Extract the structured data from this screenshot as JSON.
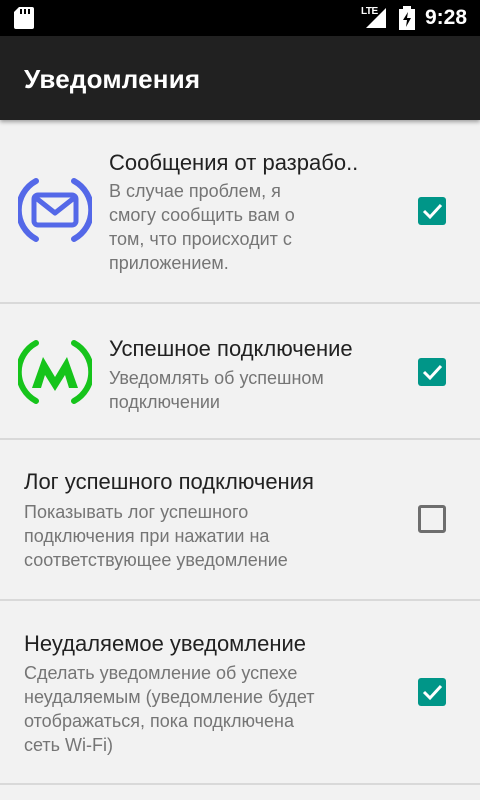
{
  "status_bar": {
    "time": "9:28",
    "network": "LTE",
    "icons": [
      "sd-card-icon",
      "signal-icon",
      "battery-charging-icon"
    ]
  },
  "app_bar": {
    "title": "Уведомления"
  },
  "colors": {
    "accent": "#009688",
    "app_bar": "#212121",
    "developer_icon": "#5468e8",
    "metro_icon": "#16c41b"
  },
  "settings": [
    {
      "title": "Сообщения от разрабо..",
      "summary": [
        "В случае проблем, я",
        "смогу сообщить вам о",
        "том, что происходит с",
        "приложением."
      ],
      "checked": true,
      "icon": "developer-message-icon"
    },
    {
      "title": "Успешное подключение",
      "summary": [
        "Уведомлять об успешном",
        "подключении"
      ],
      "checked": true,
      "icon": "metro-icon"
    },
    {
      "title": "Лог успешного подключения",
      "summary": [
        "Показывать лог успешного",
        "подключения при нажатии на",
        "соответствующее уведомление"
      ],
      "checked": false
    },
    {
      "title": "Неудаляемое уведомление",
      "summary": [
        "Сделать уведомление об успехе",
        "неудаляемым (уведомление будет",
        "отображаться, пока подключена",
        "сеть Wi-Fi)"
      ],
      "checked": true
    }
  ]
}
